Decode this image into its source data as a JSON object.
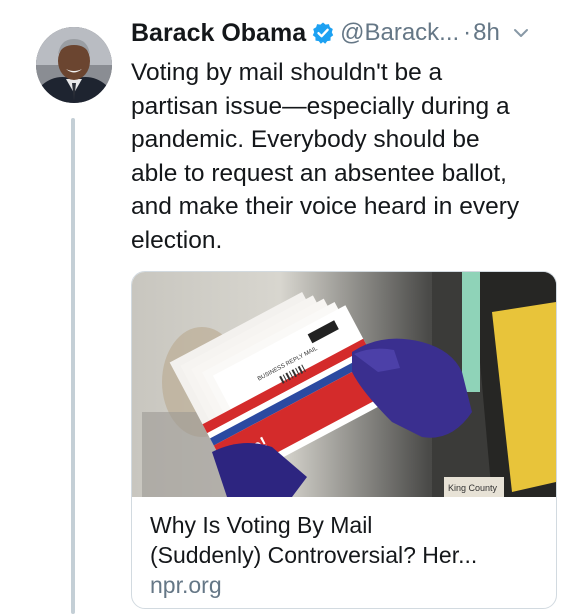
{
  "tweet": {
    "author_name": "Barack Obama",
    "handle": "@Barack...",
    "separator": "·",
    "timestamp": "8h",
    "text_lines": [
      "Voting by mail shouldn't be a",
      "partisan issue—especially during a",
      "pandemic. Everybody should be",
      "able to request an absentee ballot,",
      "and make their voice heard in every",
      "election."
    ],
    "verified": true
  },
  "link_card": {
    "title_lines": [
      "Why Is Voting By Mail",
      "(Suddenly) Controversial? Her..."
    ],
    "domain": "npr.org",
    "image_text": {
      "envelope_brand": "vote!",
      "envelope_mark": "BUSINESS REPLY MAIL",
      "badge_label": "King County"
    }
  },
  "icons": {
    "verified": "verified-badge-icon",
    "menu": "chevron-down-icon"
  },
  "colors": {
    "text": "#14171a",
    "secondary": "#657786",
    "verified_blue": "#1da1f2",
    "thread_line": "#c4cfd6",
    "card_border": "#d2dae0"
  }
}
